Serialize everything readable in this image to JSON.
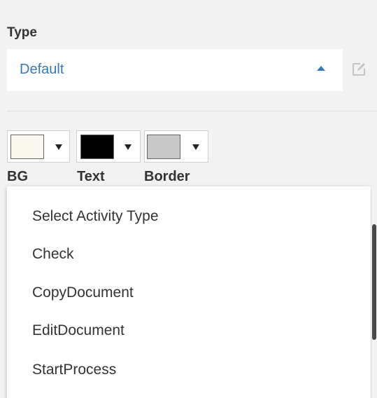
{
  "type_field": {
    "label": "Type",
    "value": "Default"
  },
  "colors": [
    {
      "label": "BG",
      "swatch": "#faf7ee"
    },
    {
      "label": "Text",
      "swatch": "#000000"
    },
    {
      "label": "Border",
      "swatch": "#c8c8c8"
    }
  ],
  "dropdown": {
    "items": [
      "Select Activity Type",
      "Check",
      "CopyDocument",
      "EditDocument",
      "StartProcess"
    ]
  },
  "accent_color": "#3579b8"
}
